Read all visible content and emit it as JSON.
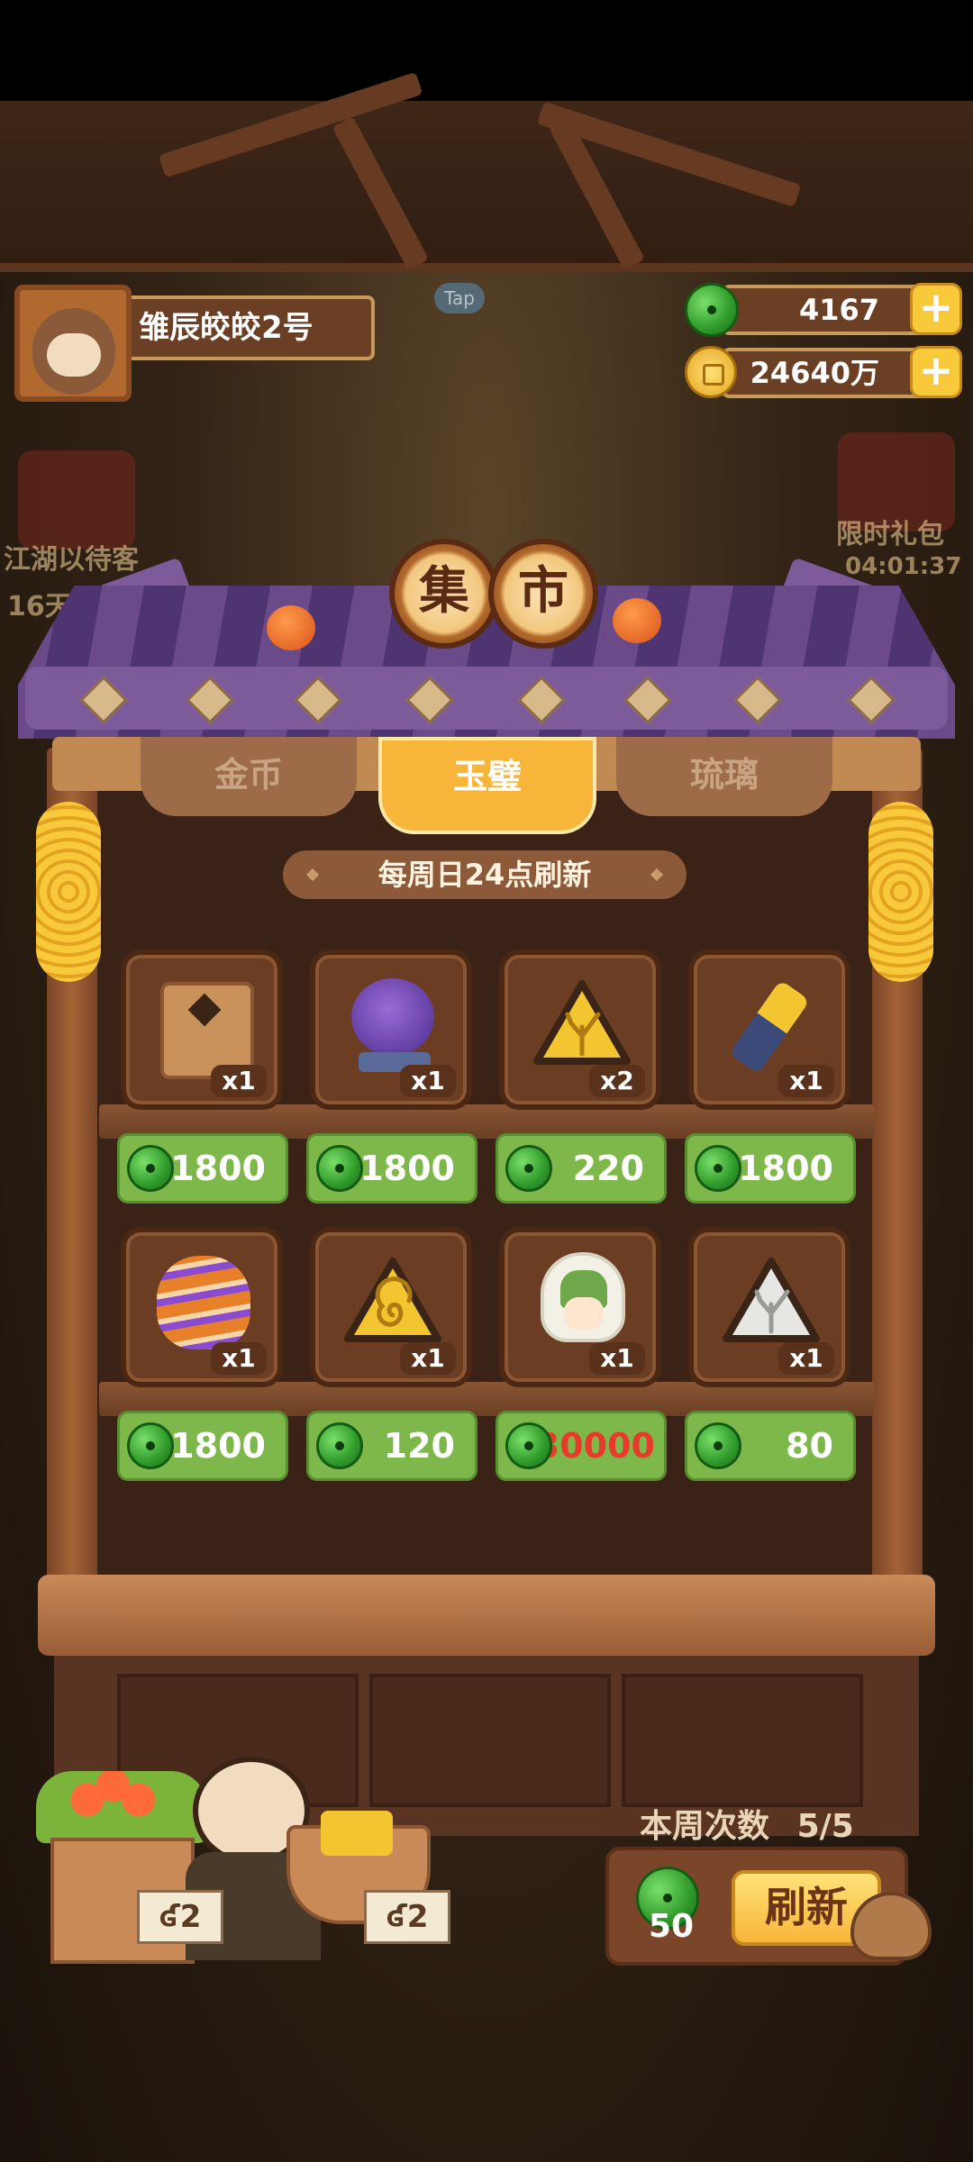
{
  "player": {
    "name": "雏辰皎皎2号"
  },
  "currencies": {
    "jade": "4167",
    "coins": "24640万"
  },
  "background": {
    "tap_hint": "Tap",
    "event_left_label": "江湖以待客",
    "event_left_timer": "16天16",
    "event_right_label": "限时礼包",
    "event_right_timer": "04:01:37"
  },
  "market": {
    "title_chars": [
      "集",
      "市"
    ],
    "tabs": [
      {
        "label": "金币",
        "active": false
      },
      {
        "label": "玉璧",
        "active": true
      },
      {
        "label": "琉璃",
        "active": false
      }
    ],
    "refresh_note": "每周日24点刷新",
    "items": [
      {
        "icon": "treasure-chest-icon",
        "qty": "x1",
        "price": "1800",
        "affordable": true
      },
      {
        "icon": "purple-cat-statue-icon",
        "qty": "x1",
        "price": "1800",
        "affordable": true
      },
      {
        "icon": "gold-coral-token-icon",
        "qty": "x2",
        "price": "220",
        "affordable": true
      },
      {
        "icon": "puppet-arm-icon",
        "qty": "x1",
        "price": "1800",
        "affordable": true
      },
      {
        "icon": "flower-vase-icon",
        "qty": "x1",
        "price": "1800",
        "affordable": true
      },
      {
        "icon": "gold-spiral-token-icon",
        "qty": "x1",
        "price": "120",
        "affordable": true
      },
      {
        "icon": "green-hair-character-icon",
        "qty": "x1",
        "price": "30000",
        "affordable": false
      },
      {
        "icon": "silver-coral-token-icon",
        "qty": "x1",
        "price": "80",
        "affordable": true
      }
    ],
    "stall_signs": [
      "ʛ2",
      "ʛ2"
    ],
    "weekly_label": "本周次数",
    "weekly_count": "5/5",
    "refresh_cost": "50",
    "refresh_button": "刷新"
  },
  "colors": {
    "jade_green": "#3fae34",
    "price_bg": "#7fb84a",
    "tab_active": "#f7b63a",
    "unaffordable": "#e83a2a"
  }
}
